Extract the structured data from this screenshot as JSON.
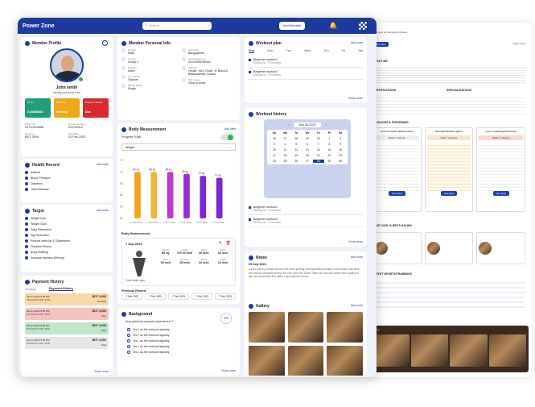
{
  "app": {
    "title": "Power Zone",
    "search_placeholder": "Search",
    "add_member": "Add Member"
  },
  "profile": {
    "title": "Member Profile",
    "name": "John smith",
    "email": "info@powerzone.com",
    "tiles": [
      {
        "label": "ID No",
        "value": "0154865682",
        "color": "#1f9e7a"
      },
      {
        "label": "Package",
        "value": "Monthly",
        "color": "#f0a81a"
      },
      {
        "label": "Payment Status",
        "value": "Due",
        "color": "#d92b2b"
      }
    ],
    "facts": [
      {
        "label": "Phone No",
        "value": "01710123456"
      },
      {
        "label": "Current Invoice",
        "value": "INV-00012"
      },
      {
        "label": "Reg Fee",
        "value": "BDT 3000"
      },
      {
        "label": "Due Date",
        "value": "01 Feb 2023"
      }
    ]
  },
  "health": {
    "title": "Health Record",
    "add": "Add more",
    "items": [
      "Asthma",
      "Blood Pressure",
      "Diabetics",
      "Heart Disease"
    ]
  },
  "target": {
    "title": "Target",
    "add": "Add more",
    "items": [
      "Weight lose",
      "Weight Gain",
      "Daily Relaxation",
      "Wg Reduction",
      "Reduce extra fat & Cholesterol",
      "Physical Fitness",
      "Body Building",
      "Increase stamina &Energy"
    ]
  },
  "payment": {
    "title": "Payment History",
    "tabs": [
      "Invoices",
      "Payment History"
    ],
    "more": "Show more",
    "entries": [
      {
        "date": "Jan 01 2023 5.00 PM",
        "inv": "#INV00012 BDT 3000",
        "amount": "BDT 3,000",
        "status": "Pending",
        "color": "#f9d8a6"
      },
      {
        "date": "Jan 01 2023 5.00 PM",
        "inv": "#INV00012 BDT 3000",
        "amount": "BDT 3,000",
        "status": "Due",
        "color": "#f7c2c2"
      },
      {
        "date": "Jan 01 2023 5.00 PM",
        "inv": "#INV00012 BDT 3000",
        "amount": "BDT 3,000",
        "status": "Paid",
        "color": "#bfe6c8"
      },
      {
        "date": "Jan 01 2023 5.00 PM",
        "inv": "#INV00012 BDT 3000",
        "amount": "BDT 3,000",
        "status": "Paid",
        "color": "#e6e6e6"
      }
    ]
  },
  "personal": {
    "title": "Member Personal Info",
    "left": [
      {
        "label": "Gender",
        "value": "Male"
      },
      {
        "label": "Groups",
        "value": "Group 1"
      },
      {
        "label": "Religion",
        "value": "Islam"
      },
      {
        "label": "Occupation",
        "value": "Teacher"
      },
      {
        "label": "Marital Status",
        "value": "Single"
      }
    ],
    "right": [
      {
        "label": "Nationality",
        "value": "Bangladeshi"
      },
      {
        "label": "Identification No",
        "value": "00123456789451"
      },
      {
        "label": "Address",
        "value": "House : 601, Road : 8, Block A, Bashundhara, Dhaka"
      },
      {
        "label": "NID Image",
        "value": "Click to show"
      }
    ]
  },
  "body": {
    "title": "Body Measurement",
    "add": "Add New",
    "track_label": "Progress Track",
    "select": "Weight",
    "ylabels": [
      "75",
      "70",
      "65",
      "60",
      "55",
      "50"
    ],
    "measure_title": "Body Measurement",
    "date": "7 Sep 2023",
    "dt_label": "Goal better type",
    "prev": "Previous Record",
    "more": "Show more",
    "metrics": [
      {
        "label": "Weight",
        "value": "80 kg"
      },
      {
        "label": "Height",
        "value": "5 ft 10 inch"
      },
      {
        "label": "Chest",
        "value": "40 inch"
      },
      {
        "label": "Waist",
        "value": "32 inch"
      },
      {
        "label": "Hips",
        "value": "35 inch"
      },
      {
        "label": "Shoulder",
        "value": "38 inch"
      },
      {
        "label": "Bicep",
        "value": "32 inch"
      },
      {
        "label": "Thigh",
        "value": "22 inch"
      }
    ],
    "prev_dates": [
      "7 Feb 2023",
      "7 Feb 2023",
      "7 Feb 2023",
      "7 Feb 2023",
      "7 Feb 2023"
    ]
  },
  "chart_data": {
    "type": "bar",
    "categories": [
      "1 Feb 2023",
      "1 Feb 2023",
      "1 Feb 2023",
      "1 Feb 2023",
      "1 Feb 2023",
      "1 Feb 2023"
    ],
    "values": [
      74,
      74,
      74,
      73,
      72,
      71
    ],
    "labels": [
      "85 kg",
      "85 kg",
      "84 kg",
      "80 kg",
      "75 kg",
      "72 kg"
    ],
    "ylim": [
      50,
      80
    ],
    "colors": [
      "#f6a21a",
      "#f0b43a",
      "#c038d0",
      "#9b2fd6",
      "#7d27d0",
      "#7d27d0"
    ]
  },
  "background": {
    "title": "Background",
    "question": "Any previous workout experience ?",
    "pct": "0%",
    "answers": [
      "Yes, I do the workout regularly",
      "Yes, I do the workout regularly",
      "Yes, I do the workout regularly",
      "Yes, I do the workout regularly",
      "Yes, I do the workout regularly"
    ],
    "more": "Show more"
  },
  "workout": {
    "title": "Workout plan",
    "add": "Add more",
    "days": [
      "Sun",
      "Mon",
      "Tue",
      "Wed",
      "Thu",
      "Fri",
      "Sat"
    ],
    "items": [
      {
        "name": "Beginner workout",
        "meta": "Monday 8:1  7 Exercises"
      },
      {
        "name": "Beginner workout",
        "meta": "Monday 8:1  7 Exercises"
      }
    ],
    "more": "Show more"
  },
  "history": {
    "title": "Workout history",
    "month": "July 28,2023",
    "wd": [
      "Su",
      "Mo",
      "Tu",
      "We",
      "Th",
      "Fr",
      "Sa"
    ],
    "days": [
      "26",
      "27",
      "28",
      "29",
      "30",
      "1",
      "2",
      "3",
      "4",
      "5",
      "6",
      "7",
      "8",
      "9",
      "10",
      "11",
      "12",
      "13",
      "14",
      "15",
      "16",
      "17",
      "18",
      "19",
      "20",
      "21",
      "22",
      "23",
      "24",
      "25",
      "26",
      "27",
      "28",
      "29",
      "30"
    ],
    "items": [
      {
        "name": "Beginner workout",
        "meta": "Monday 8:1  7 Exercises"
      },
      {
        "name": "Beginner workout",
        "meta": "Monday 8:1  7 Exercises"
      }
    ],
    "more": "Show more"
  },
  "notes": {
    "title": "Notes",
    "add": "Add more",
    "date": "09 Sep 2023",
    "text": "Lorem Ipsum is simply dummy text of the printing and typesetting industry. Lorem Ipsum has been the industry standard dummy text ever since the 1500s, when an unknown printer took a galley of type and scrambled it to make a type specimen book.",
    "more": "Show more"
  },
  "gallery": {
    "title": "Gallery",
    "add": "Add more"
  },
  "bg_site": {
    "banner": "Best Gym for Strength & Fitness",
    "about": "ABOUT ME",
    "pricing": "PACKAGES & PROGRAMS",
    "certs": "CERTIFICATIONS",
    "specs": "SPECIALIZATIONS",
    "clients": "WHAT OUR CLIENTS SAYING",
    "latest": "LATEST SPORTS/TRAININGS",
    "learn": "Learn more",
    "apply": "Join Now",
    "gallery": "Gallery",
    "view": "View all",
    "plans": [
      {
        "name": "Fit From Home (Online Only)",
        "price": "$100 / 3 Weeks"
      },
      {
        "name": "Strength Builder Hybrid",
        "price": "$150 / 4 Weeks"
      },
      {
        "name": "1-on-1 Coaching (Premium)",
        "price": "$400 / 4 Weeks"
      }
    ]
  }
}
